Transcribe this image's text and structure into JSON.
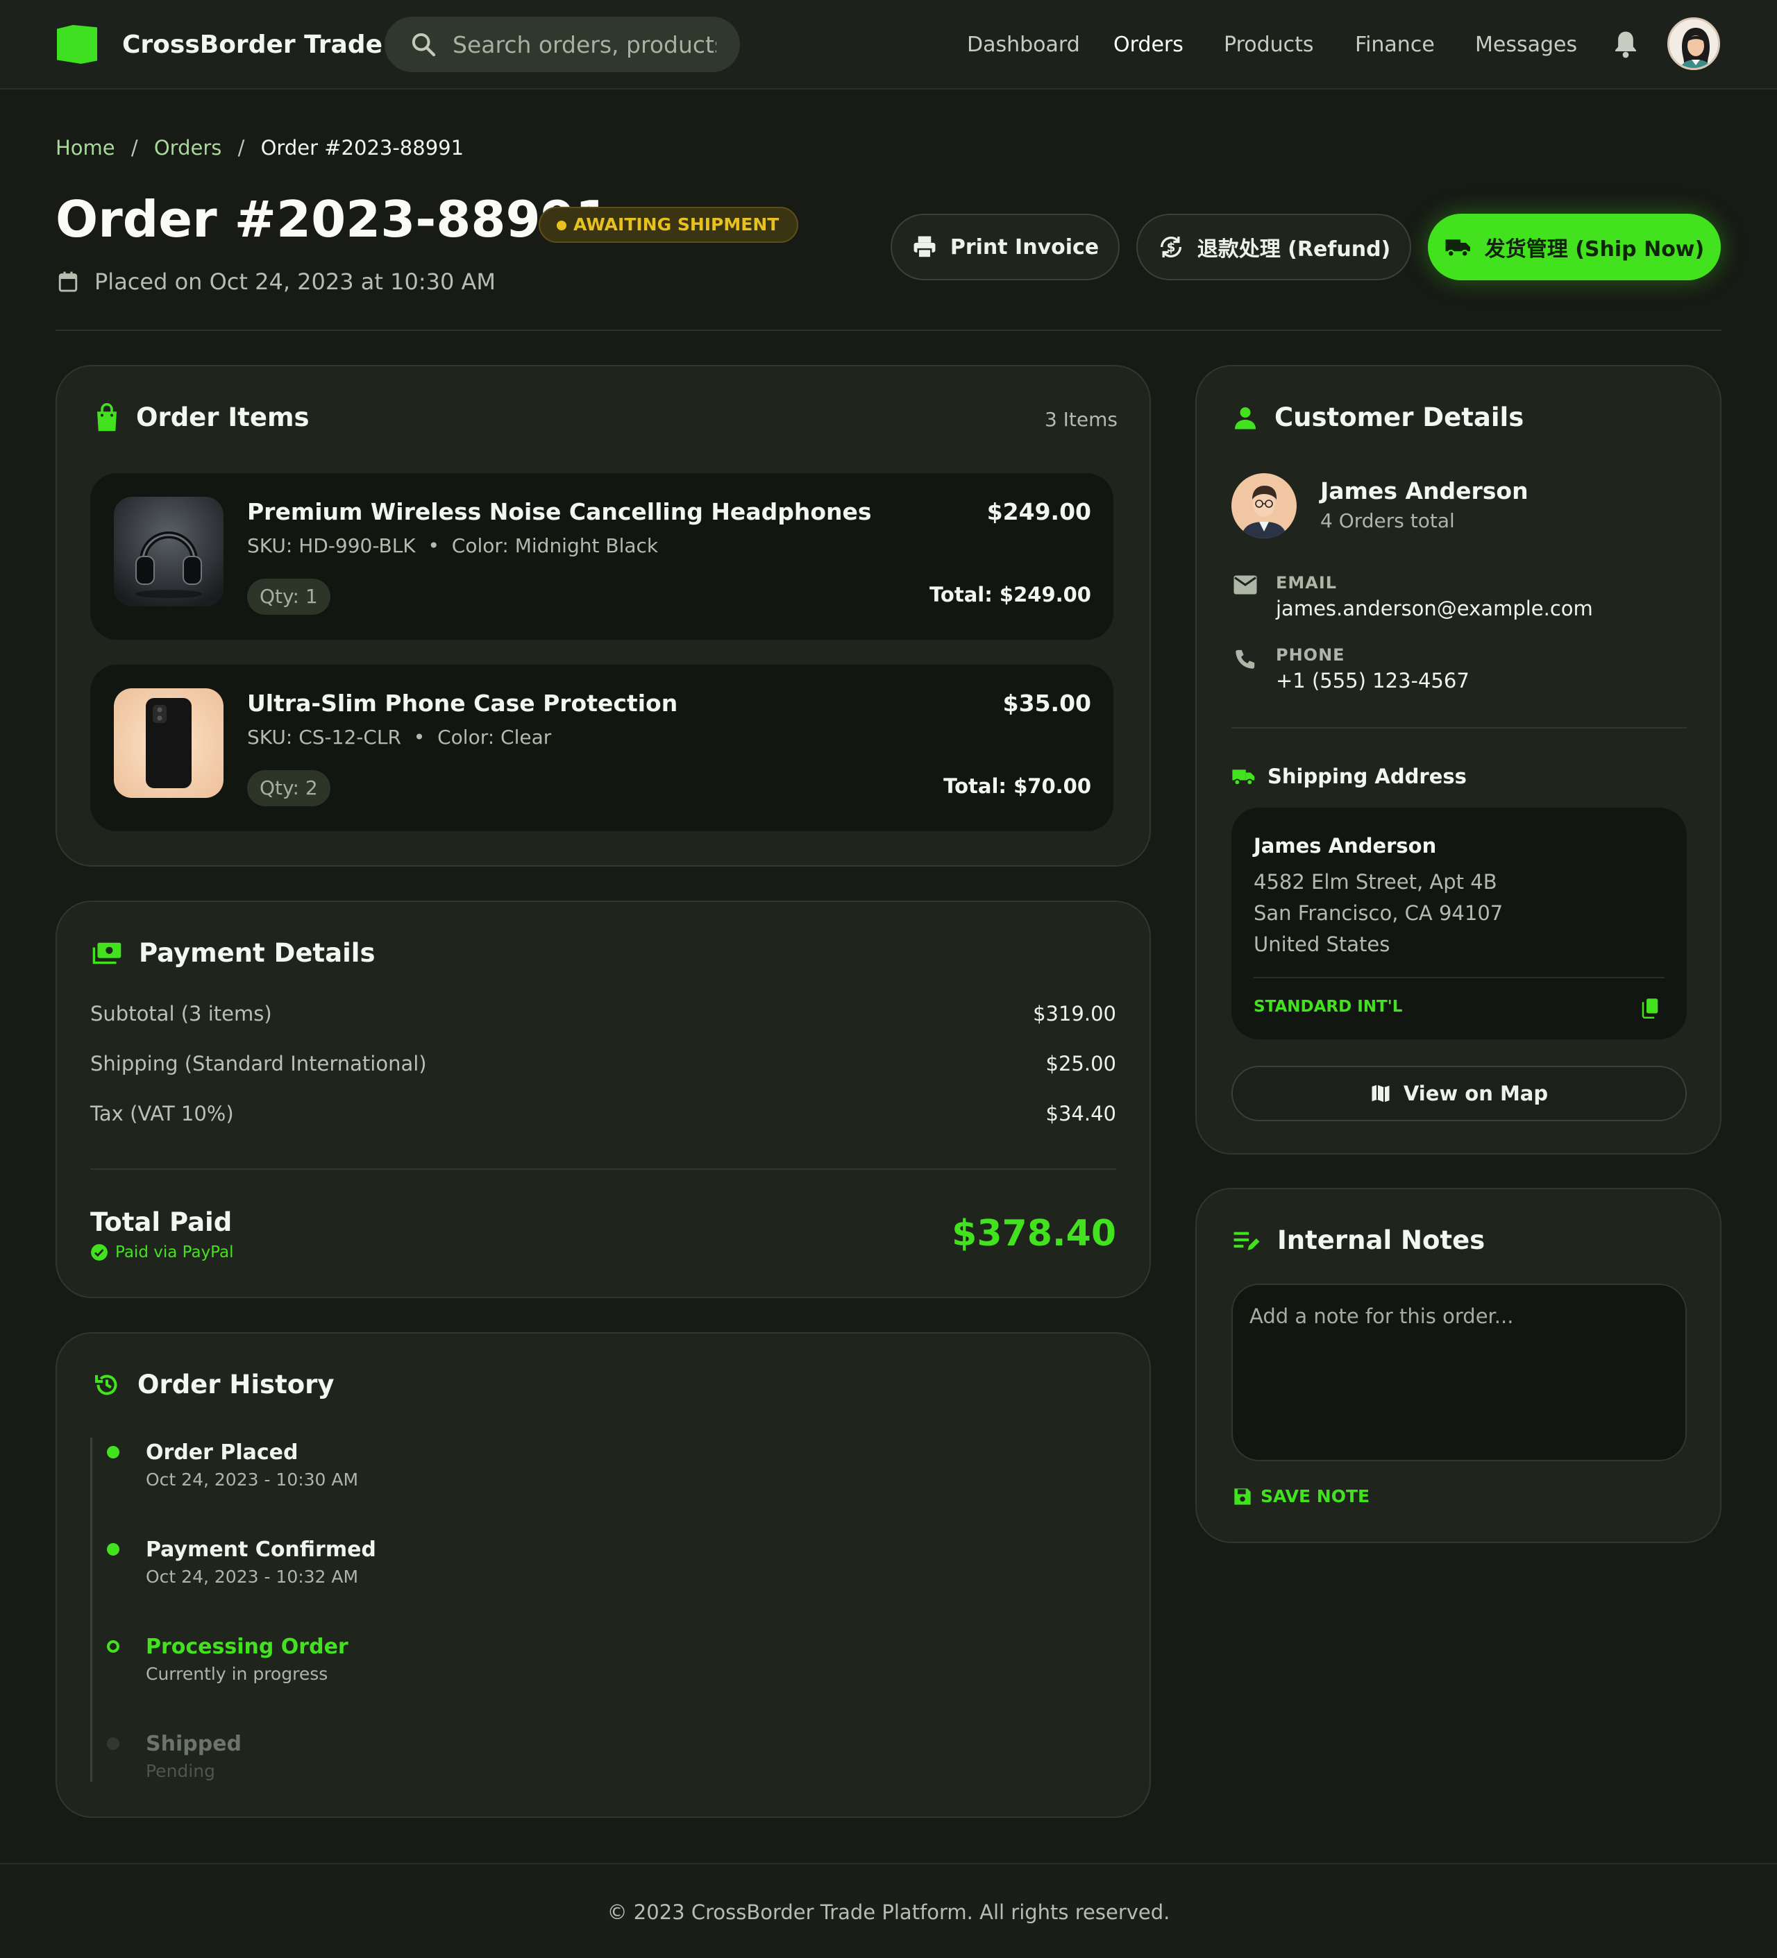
{
  "app": {
    "name": "CrossBorder Trade"
  },
  "search": {
    "placeholder": "Search orders, products..."
  },
  "nav": {
    "items": [
      "Dashboard",
      "Orders",
      "Products",
      "Finance",
      "Messages"
    ],
    "active": "Orders"
  },
  "breadcrumb": {
    "home": "Home",
    "orders": "Orders",
    "current": "Order #2023-88991",
    "separator": "/"
  },
  "order": {
    "title": "Order #2023-88991",
    "status": "AWAITING SHIPMENT",
    "placed": "Placed on Oct 24, 2023 at 10:30 AM"
  },
  "actions": {
    "print": "Print Invoice",
    "refund": "退款处理 (Refund)",
    "ship": "发货管理 (Ship Now)"
  },
  "items_card": {
    "title": "Order Items",
    "count": "3 Items",
    "items": [
      {
        "name": "Premium Wireless Noise Cancelling Headphones",
        "price": "$249.00",
        "sku": "SKU: HD-990-BLK",
        "color": "Color: Midnight Black",
        "qty": "Qty: 1",
        "total": "Total: $249.00"
      },
      {
        "name": "Ultra-Slim Phone Case Protection",
        "price": "$35.00",
        "sku": "SKU: CS-12-CLR",
        "color": "Color: Clear",
        "qty": "Qty: 2",
        "total": "Total: $70.00"
      }
    ]
  },
  "payment": {
    "title": "Payment Details",
    "rows": [
      {
        "label": "Subtotal (3 items)",
        "value": "$319.00"
      },
      {
        "label": "Shipping (Standard International)",
        "value": "$25.00"
      },
      {
        "label": "Tax (VAT 10%)",
        "value": "$34.40"
      }
    ],
    "total_label": "Total Paid",
    "total_value": "$378.40",
    "method": "Paid via PayPal"
  },
  "history": {
    "title": "Order History",
    "events": [
      {
        "title": "Order Placed",
        "sub": "Oct 24, 2023 - 10:30 AM"
      },
      {
        "title": "Payment Confirmed",
        "sub": "Oct 24, 2023 - 10:32 AM"
      },
      {
        "title": "Processing Order",
        "sub": "Currently in progress"
      },
      {
        "title": "Shipped",
        "sub": "Pending"
      }
    ]
  },
  "customer": {
    "title": "Customer Details",
    "name": "James Anderson",
    "orders": "4 Orders total",
    "email_label": "EMAIL",
    "email": "james.anderson@example.com",
    "phone_label": "PHONE",
    "phone": "+1 (555) 123-4567",
    "shipping_title": "Shipping Address",
    "address": {
      "name": "James Anderson",
      "line1": "4582 Elm Street, Apt 4B",
      "line2": "San Francisco, CA 94107",
      "country": "United States",
      "method": "STANDARD INT'L"
    },
    "map_button": "View on Map"
  },
  "notes": {
    "title": "Internal Notes",
    "placeholder": "Add a note for this order...",
    "save": "SAVE NOTE"
  },
  "footer": {
    "text": "© 2023 CrossBorder Trade Platform. All rights reserved."
  },
  "colors": {
    "accent": "#43e21f",
    "background": "#171a15",
    "card": "#1f241d",
    "warning": "#e7c11f"
  },
  "icons": [
    "brand-flag-icon",
    "search-icon",
    "bell-icon",
    "avatar",
    "calendar-icon",
    "printer-icon",
    "refund-icon",
    "truck-icon",
    "bag-icon",
    "cash-icon",
    "history-icon",
    "person-icon",
    "mail-icon",
    "phone-icon",
    "copy-icon",
    "map-icon",
    "notes-icon",
    "save-icon",
    "check-circle-icon"
  ]
}
